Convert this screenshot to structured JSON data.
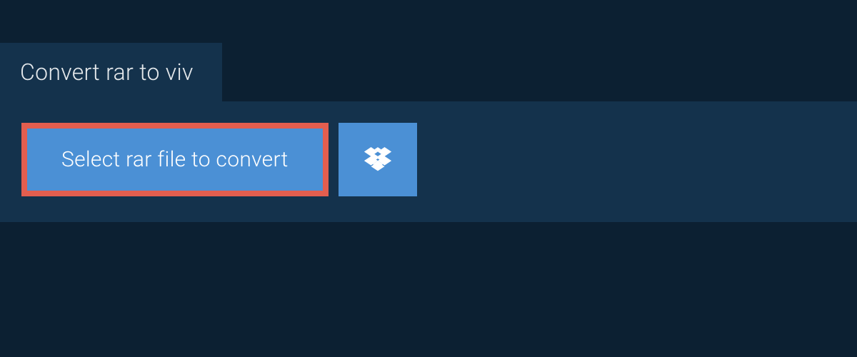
{
  "header": {
    "title": "Convert rar to viv"
  },
  "actions": {
    "select_label": "Select rar file to convert"
  }
}
